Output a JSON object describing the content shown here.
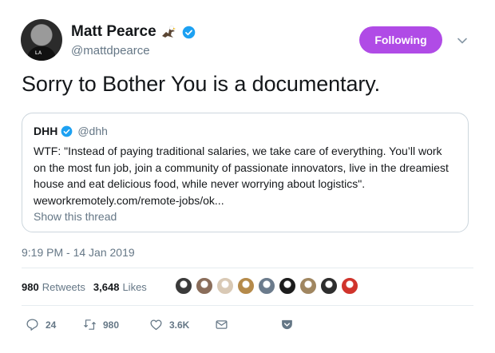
{
  "author": {
    "name": "Matt Pearce",
    "handle": "@mattdpearce",
    "avatar_shirt_text": "LA"
  },
  "follow_button": {
    "label": "Following",
    "color": "#b04be6"
  },
  "tweet": {
    "text": "Sorry to Bother You is a documentary."
  },
  "quoted": {
    "name": "DHH",
    "handle": "@dhh",
    "lines": [
      "WTF: \"Instead of paying traditional salaries, we take care of everything. You’ll work",
      "on the most fun job, join a community of passionate innovators, live in the dreamiest",
      "house and eat delicious food, while never worrying about logistics\".",
      "weworkremotely.com/remote-jobs/ok..."
    ],
    "show_thread": "Show this thread"
  },
  "timestamp": "9:19 PM - 14 Jan 2019",
  "stats": {
    "retweets_count": "980",
    "retweets_label": "Retweets",
    "likes_count": "3,648",
    "likes_label": "Likes"
  },
  "liker_avatar_colors": [
    "#3a3a3a",
    "#8a6d5a",
    "#d9c9b5",
    "#b58a4a",
    "#6b7b8c",
    "#1c1c1c",
    "#a08660",
    "#2e2e2e",
    "#d0342c"
  ],
  "actions": {
    "replies": "24",
    "retweets": "980",
    "likes": "3.6K"
  },
  "colors": {
    "accent": "#1da1f2",
    "muted": "#657786",
    "verified": "#1da1f2"
  }
}
